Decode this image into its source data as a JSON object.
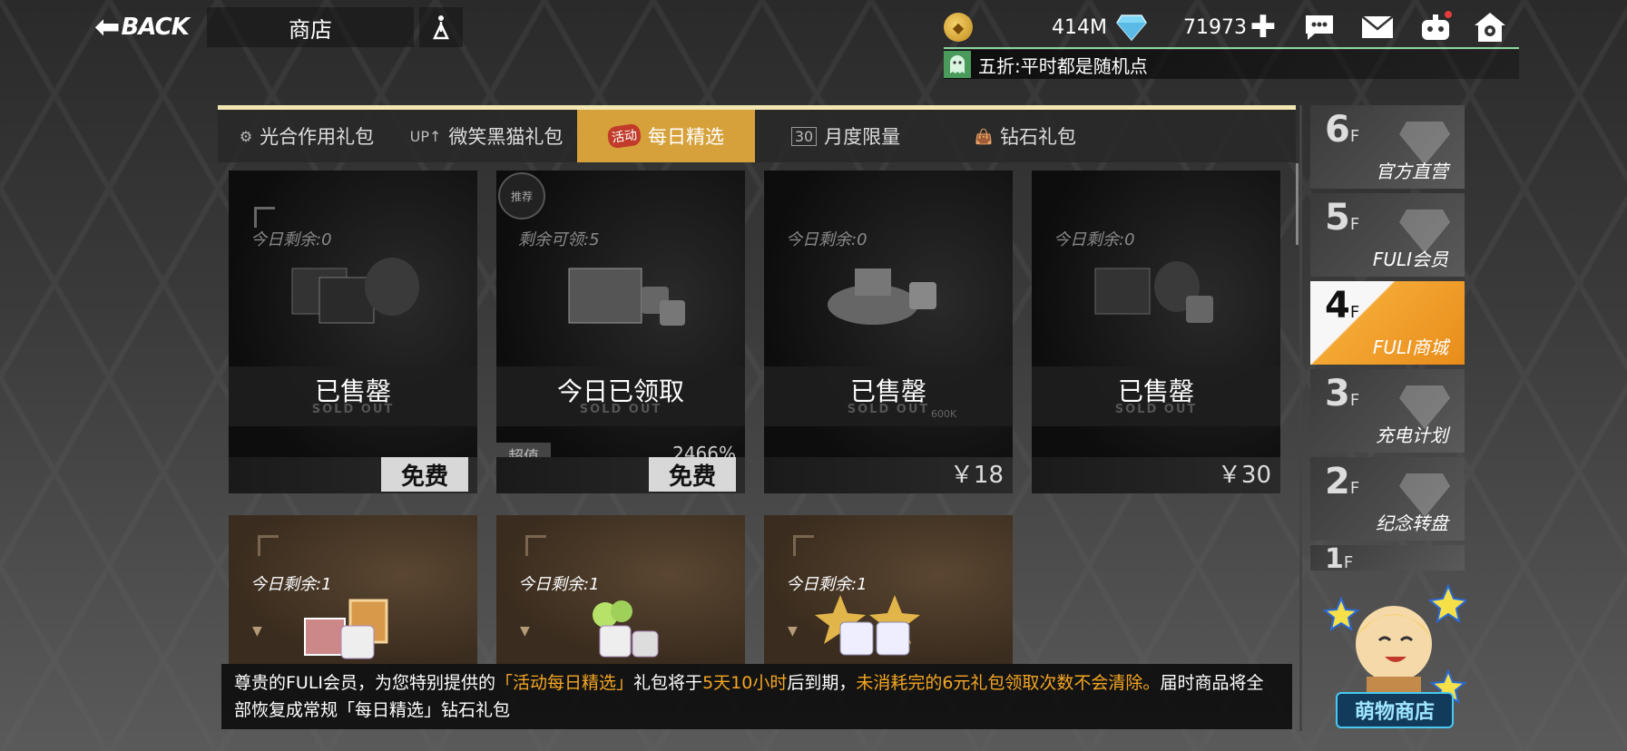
{
  "header": {
    "back_label": "BACK",
    "title": "商店",
    "gold": "414M",
    "diamonds": "71973",
    "notice": "五折:平时都是随机点"
  },
  "tabs": [
    {
      "label": "光合作用礼包",
      "icon": "sun-gear-icon"
    },
    {
      "label": "微笑黑猫礼包",
      "icon": "up-badge-icon"
    },
    {
      "label": "每日精选",
      "icon": "活动",
      "active": true
    },
    {
      "label": "月度限量",
      "icon": "30"
    },
    {
      "label": "钻石礼包",
      "icon": "bag-icon"
    }
  ],
  "cards": [
    {
      "stock": "今日剩余:0",
      "status": "已售罄",
      "sold": "SOLD OUT",
      "price": "免费",
      "price_type": "free"
    },
    {
      "stock": "剩余可领:5",
      "status": "今日已领取",
      "sold": "SOLD OUT",
      "price": "免费",
      "price_type": "free",
      "tag": "超值",
      "percent": "2466%",
      "badge": "推荐"
    },
    {
      "stock": "今日剩余:0",
      "status": "已售罄",
      "sold": "SOLD OUT",
      "price": "￥18",
      "price_type": "paid",
      "extra": "600K"
    },
    {
      "stock": "今日剩余:0",
      "status": "已售罄",
      "sold": "SOLD OUT",
      "price": "￥30",
      "price_type": "paid"
    },
    {
      "stock": "今日剩余:1"
    },
    {
      "stock": "今日剩余:1"
    },
    {
      "stock": "今日剩余:1"
    }
  ],
  "floors": [
    {
      "num": "6",
      "suffix": "F",
      "label": "官方直营"
    },
    {
      "num": "5",
      "suffix": "F",
      "label": "FULI会员"
    },
    {
      "num": "4",
      "suffix": "F",
      "label": "FULI商城",
      "active": true
    },
    {
      "num": "3",
      "suffix": "F",
      "label": "充电计划"
    },
    {
      "num": "2",
      "suffix": "F",
      "label": "纪念转盘"
    },
    {
      "num": "1",
      "suffix": "F",
      "label": ""
    }
  ],
  "mascot_label": "萌物商店",
  "bottom_notice": {
    "p1": "尊贵的FULI会员，为您特别提供的",
    "p2": "「活动每日精选」",
    "p3": "礼包将于",
    "p4": "5天10小时",
    "p5": "后到期，",
    "p6": "未消耗完的6元礼包领取次数不会清除。",
    "p7": "届时商品将全部恢复成常规「每日精选」钻石礼包"
  },
  "colors": {
    "accent": "#d6a13a",
    "highlight": "#f5a623",
    "floor_active": "#f4a734"
  }
}
